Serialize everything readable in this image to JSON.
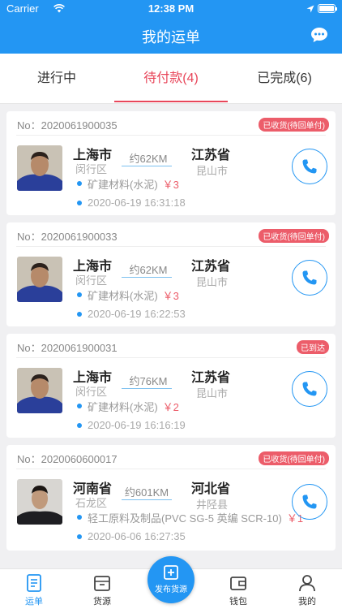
{
  "status_bar": {
    "carrier": "Carrier",
    "time": "12:38 PM"
  },
  "header": {
    "title": "我的运单",
    "chat_icon": "chat-bubble-icon"
  },
  "tabs": [
    {
      "label": "进行中",
      "active": false
    },
    {
      "label": "待付款(4)",
      "active": true
    },
    {
      "label": "已完成(6)",
      "active": false
    }
  ],
  "orders": [
    {
      "no": "No：2020061900035",
      "status": "已收货(待回单付)",
      "from_city": "上海市",
      "from_district": "闵行区",
      "distance": "约62KM",
      "to_city": "江苏省",
      "to_district": "昆山市",
      "cargo": "矿建材料(水泥)",
      "price": "￥3",
      "time": "2020-06-19 16:31:18"
    },
    {
      "no": "No：2020061900033",
      "status": "已收货(待回单付)",
      "from_city": "上海市",
      "from_district": "闵行区",
      "distance": "约62KM",
      "to_city": "江苏省",
      "to_district": "昆山市",
      "cargo": "矿建材料(水泥)",
      "price": "￥3",
      "time": "2020-06-19 16:22:53"
    },
    {
      "no": "No：2020061900031",
      "status": "已到达",
      "from_city": "上海市",
      "from_district": "闵行区",
      "distance": "约76KM",
      "to_city": "江苏省",
      "to_district": "昆山市",
      "cargo": "矿建材料(水泥)",
      "price": "￥2",
      "time": "2020-06-19 16:16:19"
    },
    {
      "no": "No：2020060600017",
      "status": "已收货(待回单付)",
      "from_city": "河南省",
      "from_district": "石龙区",
      "distance": "约601KM",
      "to_city": "河北省",
      "to_district": "井陉县",
      "cargo": "轻工原料及制品(PVC SG-5 英编  SCR-10)",
      "price": "￥1",
      "time": "2020-06-06 16:27:35"
    }
  ],
  "bottom_nav": {
    "waybill": "运单",
    "cargo_source": "货源",
    "publish": "发布货源",
    "wallet": "钱包",
    "mine": "我的"
  },
  "colors": {
    "primary": "#2396f3",
    "accent": "#e8465a",
    "badge": "#ec5d6a"
  }
}
